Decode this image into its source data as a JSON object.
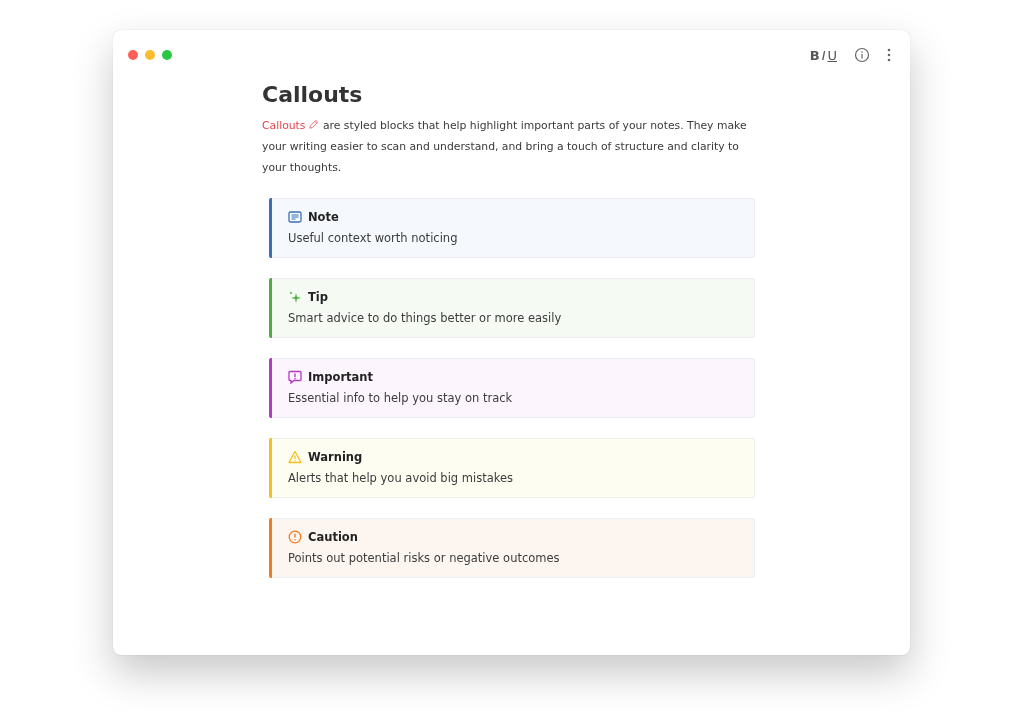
{
  "toolbar": [
    {
      "kind": "bold",
      "label": "B"
    },
    {
      "kind": "italic",
      "label": "I"
    },
    {
      "kind": "underline",
      "label": "U"
    }
  ],
  "page": {
    "title": "Callouts",
    "intro": {
      "link": "Callouts",
      "text": "are styled blocks that help highlight important parts of your notes. They make your writing easier to scan and understand, and bring a touch of structure and clarity to your thoughts."
    }
  },
  "callouts": [
    {
      "kind": "note",
      "color": "#3b6fb6",
      "title": "Note",
      "text": "Useful context worth noticing"
    },
    {
      "kind": "tip",
      "color": "#4caf3f",
      "title": "Tip",
      "text": "Smart advice to do things better or more easily"
    },
    {
      "kind": "important",
      "color": "#b13bc2",
      "title": "Important",
      "text": "Essential info to help you stay on track"
    },
    {
      "kind": "warning",
      "color": "#f4c020",
      "title": "Warning",
      "text": "Alerts that help you avoid big mistakes"
    },
    {
      "kind": "caution",
      "color": "#f47a20",
      "title": "Caution",
      "text": "Points out potential risks or negative outcomes"
    }
  ]
}
